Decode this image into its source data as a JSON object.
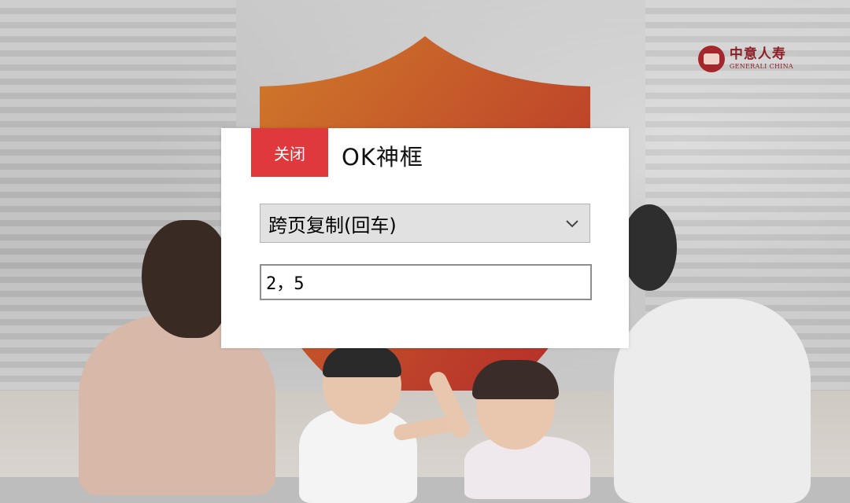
{
  "logo": {
    "name_cn": "中意人寿",
    "name_en": "GENERALI CHINA"
  },
  "dialog": {
    "close_label": "关闭",
    "title": "OK神框",
    "mode_select": {
      "selected": "跨页复制(回车)"
    },
    "input": {
      "value": "2，5"
    }
  },
  "colors": {
    "close_button": "#e0393d",
    "brand": "#8d1f26",
    "shield_top": "#cf6a2a",
    "shield_bottom": "#b52a2a"
  },
  "icons": [
    "chevron-down-icon",
    "generali-logo-icon",
    "shield-graphic"
  ]
}
